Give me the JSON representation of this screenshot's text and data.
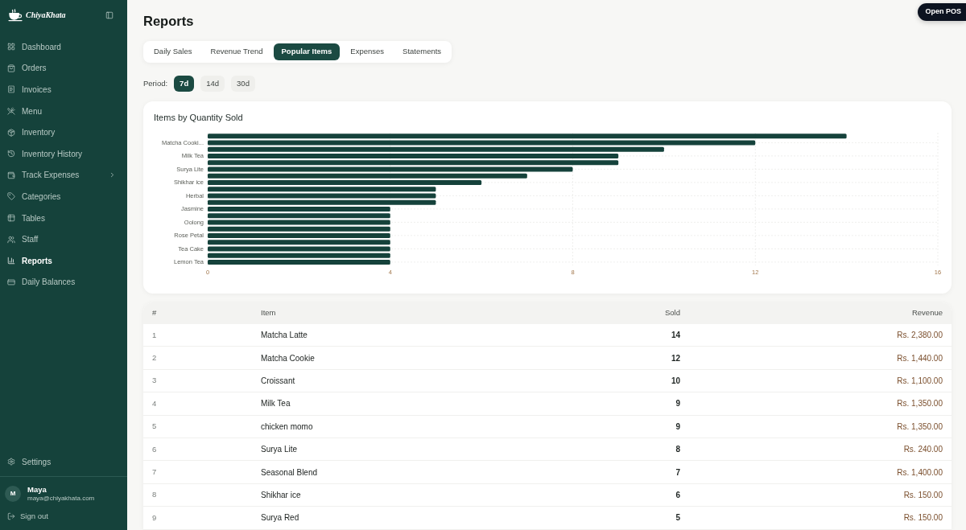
{
  "sidebar": {
    "brand": "ChiyaKhata",
    "nav": [
      {
        "label": "Dashboard",
        "kind": "link",
        "selected": false
      },
      {
        "label": "Orders",
        "kind": "link",
        "selected": false
      },
      {
        "label": "Invoices",
        "kind": "link",
        "selected": false
      },
      {
        "label": "Menu",
        "kind": "link",
        "selected": false
      },
      {
        "label": "Inventory",
        "kind": "link",
        "selected": false
      },
      {
        "label": "Inventory History",
        "kind": "link",
        "selected": false
      },
      {
        "label": "Track Expenses",
        "kind": "group",
        "selected": false,
        "expanded": false
      },
      {
        "label": "Categories",
        "kind": "link",
        "selected": false
      },
      {
        "label": "Tables",
        "kind": "link",
        "selected": false
      },
      {
        "label": "Staff",
        "kind": "link",
        "selected": false
      },
      {
        "label": "Reports",
        "kind": "link",
        "selected": true
      },
      {
        "label": "Daily Balances",
        "kind": "link",
        "selected": false
      }
    ],
    "settings": "Settings",
    "user": {
      "initial": "M",
      "name": "Maya",
      "email": "maya@chiyakhata.com"
    },
    "sign_out": "Sign out"
  },
  "header": {
    "title": "Reports",
    "open_pos": "Open POS"
  },
  "tabs": [
    {
      "label": "Daily Sales",
      "selected": false
    },
    {
      "label": "Revenue Trend",
      "selected": false
    },
    {
      "label": "Popular Items",
      "selected": true
    },
    {
      "label": "Expenses",
      "selected": false
    },
    {
      "label": "Statements",
      "selected": false
    }
  ],
  "period": {
    "label": "Period:",
    "options": [
      {
        "label": "7d",
        "selected": true
      },
      {
        "label": "14d",
        "selected": false
      },
      {
        "label": "30d",
        "selected": false
      }
    ]
  },
  "chart": {
    "title": "Items by Quantity Sold",
    "chart_data": {
      "type": "bar",
      "orientation": "horizontal",
      "grid": true,
      "categories": [
        null,
        "Matcha Cooki...",
        null,
        "Milk Tea",
        null,
        "Surya Lite",
        null,
        "Shikhar ice",
        null,
        "Herbal",
        null,
        "Jasmine",
        null,
        "Oolong",
        null,
        "Rose Petal",
        null,
        "Tea Cake",
        null,
        "Lemon Tea"
      ],
      "values": [
        14,
        12,
        10,
        9,
        9,
        8,
        7,
        6,
        5,
        5,
        5,
        4,
        4,
        4,
        4,
        4,
        4,
        4,
        4,
        4
      ],
      "xlim": [
        0,
        16
      ],
      "xticks": [
        0,
        4,
        8,
        12,
        16
      ]
    }
  },
  "table": {
    "columns": [
      "#",
      "Item",
      "Sold",
      "Revenue"
    ],
    "rows": [
      {
        "rank": "1",
        "item": "Matcha Latte",
        "sold": "14",
        "revenue": "Rs. 2,380.00"
      },
      {
        "rank": "2",
        "item": "Matcha Cookie",
        "sold": "12",
        "revenue": "Rs. 1,440.00"
      },
      {
        "rank": "3",
        "item": "Croissant",
        "sold": "10",
        "revenue": "Rs. 1,100.00"
      },
      {
        "rank": "4",
        "item": "Milk Tea",
        "sold": "9",
        "revenue": "Rs. 1,350.00"
      },
      {
        "rank": "5",
        "item": "chicken momo",
        "sold": "9",
        "revenue": "Rs. 1,350.00"
      },
      {
        "rank": "6",
        "item": "Surya Lite",
        "sold": "8",
        "revenue": "Rs. 240.00"
      },
      {
        "rank": "7",
        "item": "Seasonal Blend",
        "sold": "7",
        "revenue": "Rs. 1,400.00"
      },
      {
        "rank": "8",
        "item": "Shikhar ice",
        "sold": "6",
        "revenue": "Rs. 150.00"
      },
      {
        "rank": "9",
        "item": "Surya Red",
        "sold": "5",
        "revenue": "Rs. 150.00"
      }
    ]
  }
}
